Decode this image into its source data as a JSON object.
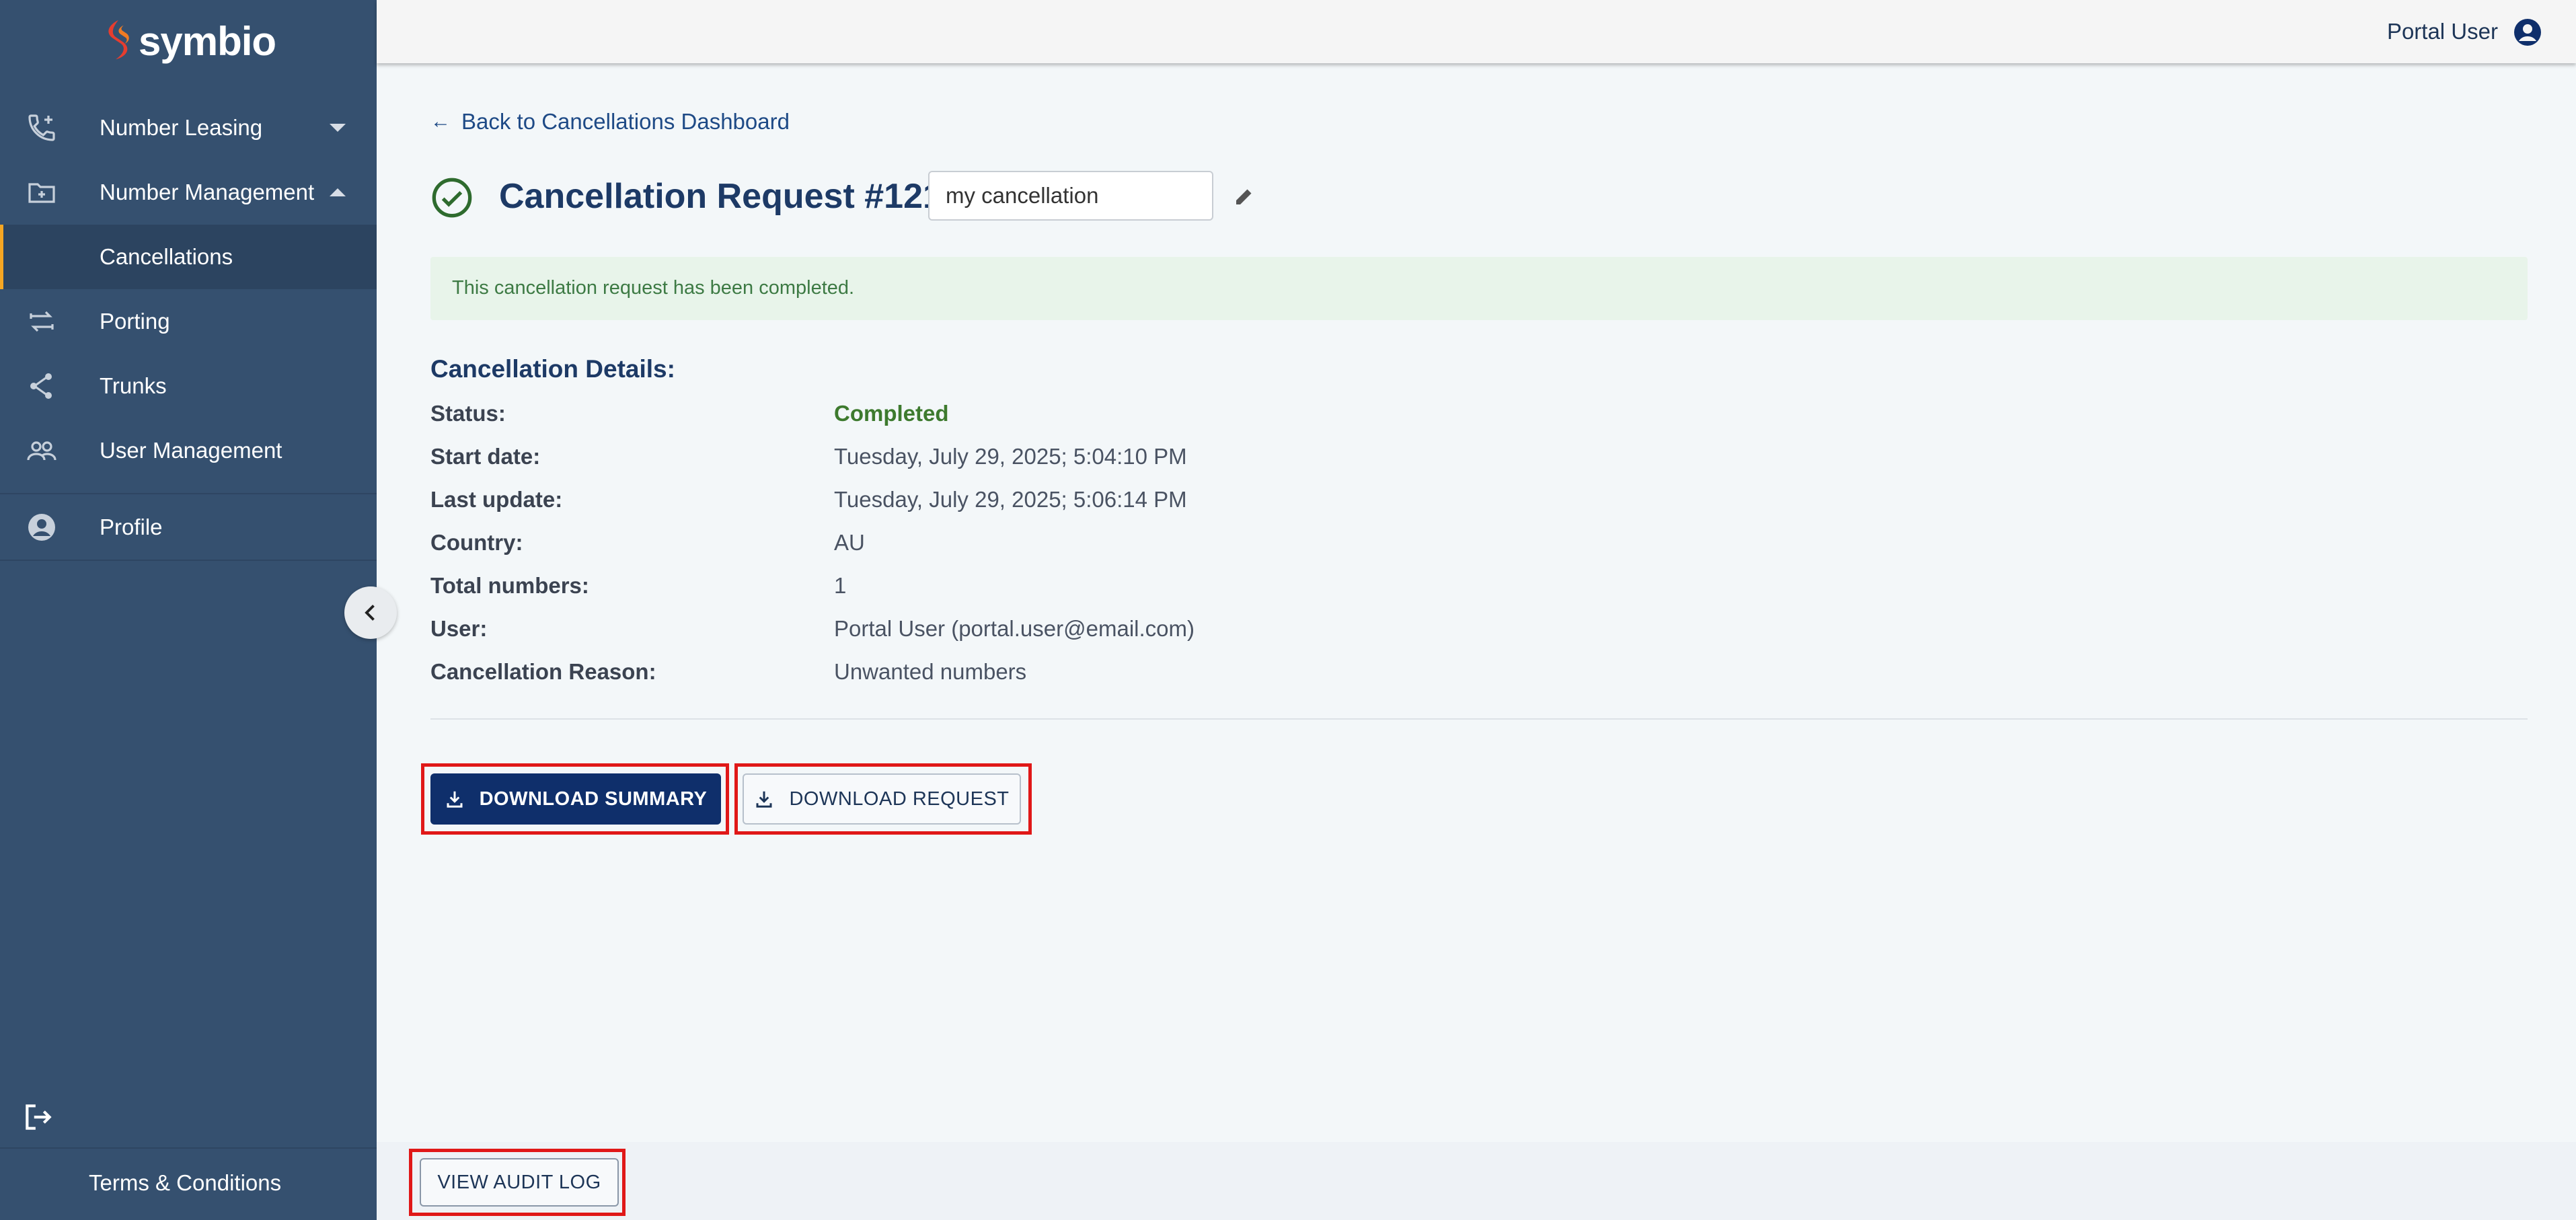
{
  "app": {
    "logo_text": "symbio"
  },
  "sidebar": {
    "items": [
      {
        "label": "Number Leasing",
        "icon": "phone-add-icon",
        "expanded": false
      },
      {
        "label": "Number Management",
        "icon": "folder-add-icon",
        "expanded": true
      },
      {
        "label": "Cancellations",
        "active": true
      },
      {
        "label": "Porting",
        "icon": "swap-icon"
      },
      {
        "label": "Trunks",
        "icon": "share-icon"
      },
      {
        "label": "User Management",
        "icon": "people-icon"
      },
      {
        "label": "Profile",
        "icon": "account-circle-icon"
      }
    ],
    "terms_label": "Terms & Conditions",
    "accent_color": "#f5a623"
  },
  "topbar": {
    "user_name": "Portal User"
  },
  "main": {
    "back_link": "Back to Cancellations Dashboard",
    "title": "Cancellation Request #121",
    "name_value": "my cancellation",
    "alert_text": "This cancellation request has been completed.",
    "details_title": "Cancellation Details:",
    "details": [
      {
        "label": "Status:",
        "value": "Completed"
      },
      {
        "label": "Start date:",
        "value": "Tuesday, July 29, 2025; 5:04:10 PM"
      },
      {
        "label": "Last update:",
        "value": "Tuesday, July 29, 2025; 5:06:14 PM"
      },
      {
        "label": "Country:",
        "value": "AU"
      },
      {
        "label": "Total numbers:",
        "value": "1"
      },
      {
        "label": "User:",
        "value": "Portal User (portal.user@email.com)"
      },
      {
        "label": "Cancellation Reason:",
        "value": "Unwanted numbers"
      }
    ],
    "download_summary": "DOWNLOAD SUMMARY",
    "download_request": "DOWNLOAD REQUEST",
    "view_audit_log": "VIEW AUDIT LOG"
  },
  "colors": {
    "sidebar_bg": "#35506f",
    "primary": "#0f2f6b",
    "success": "#3d7a2e",
    "highlight": "#e01818"
  }
}
